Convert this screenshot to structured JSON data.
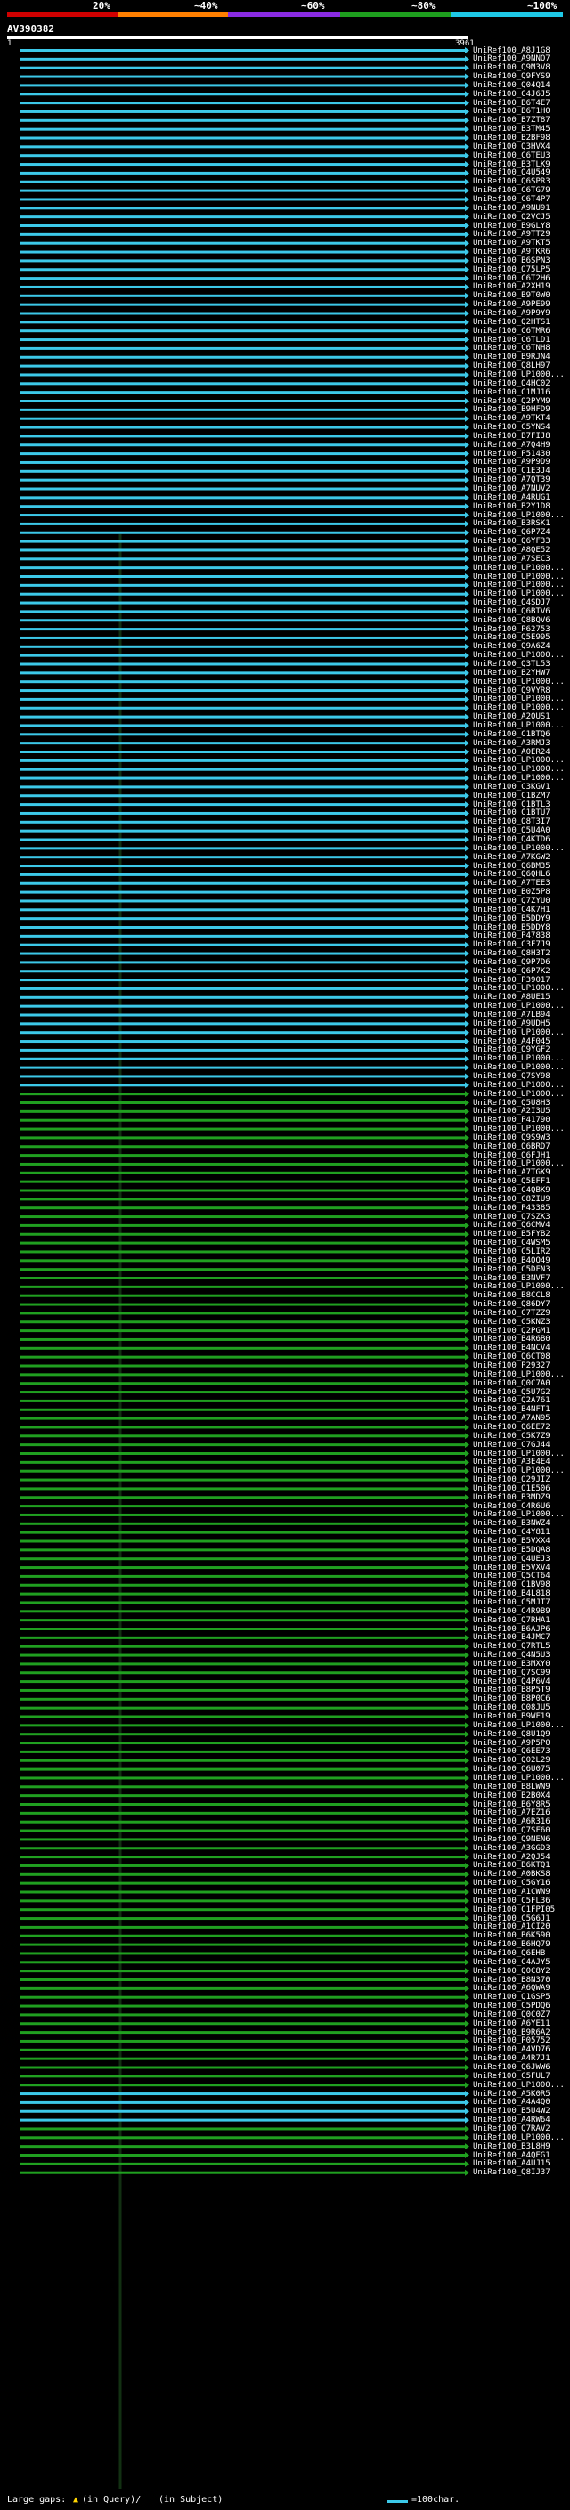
{
  "scale": {
    "labels": [
      "20%",
      "~40%",
      "~60%",
      "~80%",
      "~100%"
    ],
    "colors": [
      "#d00000",
      "#ff7f00",
      "#8a2be2",
      "#1e9e1e",
      "#1ec8e6"
    ]
  },
  "query": {
    "name": "AV390382",
    "start": "1",
    "end": "3961"
  },
  "colors": {
    "cyan": "#3cc8e8",
    "green": "#20a020",
    "dark": "#0a1a0a",
    "white": "#ffffff"
  },
  "hits": [
    {
      "label": "UniRef100_A8J1G8",
      "color": "cyan"
    },
    {
      "label": "UniRef100_A9NNQ7",
      "color": "cyan"
    },
    {
      "label": "UniRef100_Q9M3V8",
      "color": "cyan"
    },
    {
      "label": "UniRef100_Q9FYS9",
      "color": "cyan"
    },
    {
      "label": "UniRef100_Q04Q14",
      "color": "cyan"
    },
    {
      "label": "UniRef100_C4J6J5",
      "color": "cyan"
    },
    {
      "label": "UniRef100_B6T4E7",
      "color": "cyan"
    },
    {
      "label": "UniRef100_B6T1H0",
      "color": "cyan"
    },
    {
      "label": "UniRef100_B7ZT87",
      "color": "cyan"
    },
    {
      "label": "UniRef100_B3TM45",
      "color": "cyan"
    },
    {
      "label": "UniRef100_B2BF98",
      "color": "cyan"
    },
    {
      "label": "UniRef100_Q3HVX4",
      "color": "cyan"
    },
    {
      "label": "UniRef100_C6TEU3",
      "color": "cyan"
    },
    {
      "label": "UniRef100_B3TLK9",
      "color": "cyan"
    },
    {
      "label": "UniRef100_Q4U549",
      "color": "cyan"
    },
    {
      "label": "UniRef100_Q6SPR3",
      "color": "cyan"
    },
    {
      "label": "UniRef100_C6TG79",
      "color": "cyan"
    },
    {
      "label": "UniRef100_C6T4P7",
      "color": "cyan"
    },
    {
      "label": "UniRef100_A9NU91",
      "color": "cyan"
    },
    {
      "label": "UniRef100_Q2VCJ5",
      "color": "cyan"
    },
    {
      "label": "UniRef100_B9GLY8",
      "color": "cyan"
    },
    {
      "label": "UniRef100_A9TT29",
      "color": "cyan"
    },
    {
      "label": "UniRef100_A9TKT5",
      "color": "cyan"
    },
    {
      "label": "UniRef100_A9TKR6",
      "color": "cyan"
    },
    {
      "label": "UniRef100_B6SPN3",
      "color": "cyan"
    },
    {
      "label": "UniRef100_Q75LP5",
      "color": "cyan"
    },
    {
      "label": "UniRef100_C6T2H6",
      "color": "cyan"
    },
    {
      "label": "UniRef100_A2XH19",
      "color": "cyan"
    },
    {
      "label": "UniRef100_B9T0W0",
      "color": "cyan"
    },
    {
      "label": "UniRef100_A9PE99",
      "color": "cyan"
    },
    {
      "label": "UniRef100_A9P9Y9",
      "color": "cyan"
    },
    {
      "label": "UniRef100_Q2HTS1",
      "color": "cyan"
    },
    {
      "label": "UniRef100_C6TMR6",
      "color": "cyan"
    },
    {
      "label": "UniRef100_C6TLD1",
      "color": "cyan"
    },
    {
      "label": "UniRef100_C6TNH8",
      "color": "cyan"
    },
    {
      "label": "UniRef100_B9RJN4",
      "color": "cyan"
    },
    {
      "label": "UniRef100_Q8LH97",
      "color": "cyan"
    },
    {
      "label": "UniRef100_UP1000...",
      "color": "cyan"
    },
    {
      "label": "UniRef100_Q4HC02",
      "color": "cyan"
    },
    {
      "label": "UniRef100_C1MJ16",
      "color": "cyan"
    },
    {
      "label": "UniRef100_Q2PYM9",
      "color": "cyan"
    },
    {
      "label": "UniRef100_B9HFD9",
      "color": "cyan"
    },
    {
      "label": "UniRef100_A9TKT4",
      "color": "cyan"
    },
    {
      "label": "UniRef100_C5YNS4",
      "color": "cyan"
    },
    {
      "label": "UniRef100_B7FIJ8",
      "color": "cyan"
    },
    {
      "label": "UniRef100_A7Q4H9",
      "color": "cyan"
    },
    {
      "label": "UniRef100_P51430",
      "color": "cyan"
    },
    {
      "label": "UniRef100_A9P9D9",
      "color": "cyan"
    },
    {
      "label": "UniRef100_C1E3J4",
      "color": "cyan"
    },
    {
      "label": "UniRef100_A7QT39",
      "color": "cyan"
    },
    {
      "label": "UniRef100_A7NUV2",
      "color": "cyan"
    },
    {
      "label": "UniRef100_A4RUG1",
      "color": "cyan"
    },
    {
      "label": "UniRef100_B2Y1D8",
      "color": "cyan"
    },
    {
      "label": "UniRef100_UP1000...",
      "color": "cyan"
    },
    {
      "label": "UniRef100_B3RSK1",
      "color": "cyan"
    },
    {
      "label": "UniRef100_Q6P7Z4",
      "color": "cyan"
    },
    {
      "label": "UniRef100_Q6YF33",
      "color": "cyan"
    },
    {
      "label": "UniRef100_A8QE52",
      "color": "cyan"
    },
    {
      "label": "UniRef100_A7SEC3",
      "color": "cyan"
    },
    {
      "label": "UniRef100_UP1000...",
      "color": "cyan"
    },
    {
      "label": "UniRef100_UP1000...",
      "color": "cyan"
    },
    {
      "label": "UniRef100_UP1000...",
      "color": "cyan"
    },
    {
      "label": "UniRef100_UP1000...",
      "color": "cyan"
    },
    {
      "label": "UniRef100_Q4SDJ7",
      "color": "cyan"
    },
    {
      "label": "UniRef100_Q6BTV6",
      "color": "cyan"
    },
    {
      "label": "UniRef100_Q8BQV6",
      "color": "cyan"
    },
    {
      "label": "UniRef100_P62753",
      "color": "cyan"
    },
    {
      "label": "UniRef100_Q5E995",
      "color": "cyan"
    },
    {
      "label": "UniRef100_Q9A6Z4",
      "color": "cyan"
    },
    {
      "label": "UniRef100_UP1000...",
      "color": "cyan"
    },
    {
      "label": "UniRef100_Q3TL53",
      "color": "cyan"
    },
    {
      "label": "UniRef100_B2YHW7",
      "color": "cyan"
    },
    {
      "label": "UniRef100_UP1000...",
      "color": "cyan"
    },
    {
      "label": "UniRef100_Q9VYR8",
      "color": "cyan"
    },
    {
      "label": "UniRef100_UP1000...",
      "color": "cyan"
    },
    {
      "label": "UniRef100_UP1000...",
      "color": "cyan"
    },
    {
      "label": "UniRef100_A2QUS1",
      "color": "cyan"
    },
    {
      "label": "UniRef100_UP1000...",
      "color": "cyan"
    },
    {
      "label": "UniRef100_C1BTQ6",
      "color": "cyan"
    },
    {
      "label": "UniRef100_A3RMJ3",
      "color": "cyan"
    },
    {
      "label": "UniRef100_A0ER24",
      "color": "cyan"
    },
    {
      "label": "UniRef100_UP1000...",
      "color": "cyan"
    },
    {
      "label": "UniRef100_UP1000...",
      "color": "cyan"
    },
    {
      "label": "UniRef100_UP1000...",
      "color": "cyan"
    },
    {
      "label": "UniRef100_C3KGV1",
      "color": "cyan"
    },
    {
      "label": "UniRef100_C1BZM7",
      "color": "cyan"
    },
    {
      "label": "UniRef100_C1BTL3",
      "color": "cyan"
    },
    {
      "label": "UniRef100_C1BTU7",
      "color": "cyan"
    },
    {
      "label": "UniRef100_Q8T3I7",
      "color": "cyan"
    },
    {
      "label": "UniRef100_Q5U4A0",
      "color": "cyan"
    },
    {
      "label": "UniRef100_Q4KTD6",
      "color": "cyan"
    },
    {
      "label": "UniRef100_UP1000...",
      "color": "cyan"
    },
    {
      "label": "UniRef100_A7KGW2",
      "color": "cyan"
    },
    {
      "label": "UniRef100_Q6BM35",
      "color": "cyan"
    },
    {
      "label": "UniRef100_Q6QHL6",
      "color": "cyan"
    },
    {
      "label": "UniRef100_A7TEE3",
      "color": "cyan"
    },
    {
      "label": "UniRef100_B0Z5P8",
      "color": "cyan"
    },
    {
      "label": "UniRef100_Q7ZYU0",
      "color": "cyan"
    },
    {
      "label": "UniRef100_C4K7H1",
      "color": "cyan"
    },
    {
      "label": "UniRef100_B5DDY9",
      "color": "cyan"
    },
    {
      "label": "UniRef100_B5DDY8",
      "color": "cyan"
    },
    {
      "label": "UniRef100_P47838",
      "color": "cyan"
    },
    {
      "label": "UniRef100_C3F7J9",
      "color": "cyan"
    },
    {
      "label": "UniRef100_Q8H3T2",
      "color": "cyan"
    },
    {
      "label": "UniRef100_Q9P7D6",
      "color": "cyan"
    },
    {
      "label": "UniRef100_Q6P7K2",
      "color": "cyan"
    },
    {
      "label": "UniRef100_P39017",
      "color": "cyan"
    },
    {
      "label": "UniRef100_UP1000...",
      "color": "cyan"
    },
    {
      "label": "UniRef100_A8UE15",
      "color": "cyan"
    },
    {
      "label": "UniRef100_UP1000...",
      "color": "cyan"
    },
    {
      "label": "UniRef100_A7LB94",
      "color": "cyan"
    },
    {
      "label": "UniRef100_A9UDH5",
      "color": "cyan"
    },
    {
      "label": "UniRef100_UP1000...",
      "color": "cyan"
    },
    {
      "label": "UniRef100_A4F045",
      "color": "cyan"
    },
    {
      "label": "UniRef100_Q9YGF2",
      "color": "cyan"
    },
    {
      "label": "UniRef100_UP1000...",
      "color": "cyan"
    },
    {
      "label": "UniRef100_UP1000...",
      "color": "cyan"
    },
    {
      "label": "UniRef100_Q7SY98",
      "color": "cyan"
    },
    {
      "label": "UniRef100_UP1000...",
      "color": "cyan"
    },
    {
      "label": "UniRef100_UP1000...",
      "color": "green"
    },
    {
      "label": "UniRef100_Q5U8H3",
      "color": "green"
    },
    {
      "label": "UniRef100_A2I3U5",
      "color": "green"
    },
    {
      "label": "UniRef100_P41790",
      "color": "green"
    },
    {
      "label": "UniRef100_UP1000...",
      "color": "green"
    },
    {
      "label": "UniRef100_Q9S9W3",
      "color": "green"
    },
    {
      "label": "UniRef100_Q6BRD7",
      "color": "green"
    },
    {
      "label": "UniRef100_Q6FJH1",
      "color": "green"
    },
    {
      "label": "UniRef100_UP1000...",
      "color": "green"
    },
    {
      "label": "UniRef100_A7TGK9",
      "color": "green"
    },
    {
      "label": "UniRef100_Q5EFF1",
      "color": "green"
    },
    {
      "label": "UniRef100_C4QBK9",
      "color": "green"
    },
    {
      "label": "UniRef100_C8ZIU9",
      "color": "green"
    },
    {
      "label": "UniRef100_P43385",
      "color": "green"
    },
    {
      "label": "UniRef100_Q7SZK3",
      "color": "green"
    },
    {
      "label": "UniRef100_Q6CMV4",
      "color": "green"
    },
    {
      "label": "UniRef100_B5FYB2",
      "color": "green"
    },
    {
      "label": "UniRef100_C4WSM5",
      "color": "green"
    },
    {
      "label": "UniRef100_C5LIR2",
      "color": "green"
    },
    {
      "label": "UniRef100_B4QQ49",
      "color": "green"
    },
    {
      "label": "UniRef100_C5DFN3",
      "color": "green"
    },
    {
      "label": "UniRef100_B3NVF7",
      "color": "green"
    },
    {
      "label": "UniRef100_UP1000...",
      "color": "green"
    },
    {
      "label": "UniRef100_B8CCL8",
      "color": "green"
    },
    {
      "label": "UniRef100_Q86DY7",
      "color": "green"
    },
    {
      "label": "UniRef100_C7TZZ9",
      "color": "green"
    },
    {
      "label": "UniRef100_C5KNZ3",
      "color": "green"
    },
    {
      "label": "UniRef100_Q2PGM1",
      "color": "green"
    },
    {
      "label": "UniRef100_B4R6B0",
      "color": "green"
    },
    {
      "label": "UniRef100_B4NCV4",
      "color": "green"
    },
    {
      "label": "UniRef100_Q6CT08",
      "color": "green"
    },
    {
      "label": "UniRef100_P29327",
      "color": "green"
    },
    {
      "label": "UniRef100_UP1000...",
      "color": "green"
    },
    {
      "label": "UniRef100_Q0C7A0",
      "color": "green"
    },
    {
      "label": "UniRef100_Q5U7G2",
      "color": "green"
    },
    {
      "label": "UniRef100_Q2A761",
      "color": "green"
    },
    {
      "label": "UniRef100_B4NFT1",
      "color": "green"
    },
    {
      "label": "UniRef100_A7AN95",
      "color": "green"
    },
    {
      "label": "UniRef100_Q6EE72",
      "color": "green"
    },
    {
      "label": "UniRef100_C5K7Z9",
      "color": "green"
    },
    {
      "label": "UniRef100_C7GJ44",
      "color": "green"
    },
    {
      "label": "UniRef100_UP1000...",
      "color": "green"
    },
    {
      "label": "UniRef100_A3E4E4",
      "color": "green"
    },
    {
      "label": "UniRef100_UP1000...",
      "color": "green"
    },
    {
      "label": "UniRef100_Q29JIZ",
      "color": "green"
    },
    {
      "label": "UniRef100_Q1E506",
      "color": "green"
    },
    {
      "label": "UniRef100_B3MDZ9",
      "color": "green"
    },
    {
      "label": "UniRef100_C4R6U6",
      "color": "green"
    },
    {
      "label": "UniRef100_UP1000...",
      "color": "green"
    },
    {
      "label": "UniRef100_B3NWZ4",
      "color": "green"
    },
    {
      "label": "UniRef100_C4Y811",
      "color": "green"
    },
    {
      "label": "UniRef100_B5VXX4",
      "color": "green"
    },
    {
      "label": "UniRef100_B5DQA8",
      "color": "green"
    },
    {
      "label": "UniRef100_Q4UEJ3",
      "color": "green"
    },
    {
      "label": "UniRef100_B5VXV4",
      "color": "green"
    },
    {
      "label": "UniRef100_Q5CT64",
      "color": "green"
    },
    {
      "label": "UniRef100_C1BV98",
      "color": "green"
    },
    {
      "label": "UniRef100_B4L818",
      "color": "green"
    },
    {
      "label": "UniRef100_C5MJT7",
      "color": "green"
    },
    {
      "label": "UniRef100_C4R9B9",
      "color": "green"
    },
    {
      "label": "UniRef100_Q7RHA1",
      "color": "green"
    },
    {
      "label": "UniRef100_B6AJP6",
      "color": "green"
    },
    {
      "label": "UniRef100_B4JMC7",
      "color": "green"
    },
    {
      "label": "UniRef100_Q7RTL5",
      "color": "green"
    },
    {
      "label": "UniRef100_Q4N5U3",
      "color": "green"
    },
    {
      "label": "UniRef100_B3MXY0",
      "color": "green"
    },
    {
      "label": "UniRef100_Q7SC99",
      "color": "green"
    },
    {
      "label": "UniRef100_Q4P6V4",
      "color": "green"
    },
    {
      "label": "UniRef100_B8P5T9",
      "color": "green"
    },
    {
      "label": "UniRef100_B8P0C6",
      "color": "green"
    },
    {
      "label": "UniRef100_Q08JU5",
      "color": "green"
    },
    {
      "label": "UniRef100_B9WF19",
      "color": "green"
    },
    {
      "label": "UniRef100_UP1000...",
      "color": "green"
    },
    {
      "label": "UniRef100_Q8U1Q9",
      "color": "green"
    },
    {
      "label": "UniRef100_A9P5P0",
      "color": "green"
    },
    {
      "label": "UniRef100_Q6EE73",
      "color": "green"
    },
    {
      "label": "UniRef100_Q02L29",
      "color": "green"
    },
    {
      "label": "UniRef100_Q6U075",
      "color": "green"
    },
    {
      "label": "UniRef100_UP1000...",
      "color": "green"
    },
    {
      "label": "UniRef100_B8LWN9",
      "color": "green"
    },
    {
      "label": "UniRef100_B2B0X4",
      "color": "green"
    },
    {
      "label": "UniRef100_B6Y8R5",
      "color": "green"
    },
    {
      "label": "UniRef100_A7EZ16",
      "color": "green"
    },
    {
      "label": "UniRef100_A6R316",
      "color": "green"
    },
    {
      "label": "UniRef100_Q7SF60",
      "color": "green"
    },
    {
      "label": "UniRef100_Q9NEN6",
      "color": "green"
    },
    {
      "label": "UniRef100_A3GGD3",
      "color": "green"
    },
    {
      "label": "UniRef100_A2QJ54",
      "color": "green"
    },
    {
      "label": "UniRef100_B6KTQ1",
      "color": "green"
    },
    {
      "label": "UniRef100_A0BKS8",
      "color": "green"
    },
    {
      "label": "UniRef100_C5GY16",
      "color": "green"
    },
    {
      "label": "UniRef100_A1CWN9",
      "color": "green"
    },
    {
      "label": "UniRef100_C5FL36",
      "color": "green"
    },
    {
      "label": "UniRef100_C1FPI05",
      "color": "green"
    },
    {
      "label": "UniRef100_C5G6J1",
      "color": "green"
    },
    {
      "label": "UniRef100_A1CI20",
      "color": "green"
    },
    {
      "label": "UniRef100_B6K590",
      "color": "green"
    },
    {
      "label": "UniRef100_B6HQ79",
      "color": "green"
    },
    {
      "label": "UniRef100_Q6EHB",
      "color": "green"
    },
    {
      "label": "UniRef100_C4AJY5",
      "color": "green"
    },
    {
      "label": "UniRef100_Q0C8Y2",
      "color": "green"
    },
    {
      "label": "UniRef100_B8N370",
      "color": "green"
    },
    {
      "label": "UniRef100_A6QWA9",
      "color": "green"
    },
    {
      "label": "UniRef100_Q1GSP5",
      "color": "green"
    },
    {
      "label": "UniRef100_C5PDQ6",
      "color": "green"
    },
    {
      "label": "UniRef100_Q0C0Z7",
      "color": "green"
    },
    {
      "label": "UniRef100_A6YE11",
      "color": "green"
    },
    {
      "label": "UniRef100_B9R6A2",
      "color": "green"
    },
    {
      "label": "UniRef100_P05752",
      "color": "green"
    },
    {
      "label": "UniRef100_A4VD76",
      "color": "green"
    },
    {
      "label": "UniRef100_A4R7J1",
      "color": "green"
    },
    {
      "label": "UniRef100_Q6JWW6",
      "color": "green"
    },
    {
      "label": "UniRef100_C5FUL7",
      "color": "green"
    },
    {
      "label": "UniRef100_UP1000...",
      "color": "green"
    },
    {
      "label": "UniRef100_A5K0R5",
      "color": "cyan"
    },
    {
      "label": "UniRef100_A4A4Q0",
      "color": "cyan"
    },
    {
      "label": "UniRef100_B5U4W2",
      "color": "cyan"
    },
    {
      "label": "UniRef100_A4RW64",
      "color": "cyan"
    },
    {
      "label": "UniRef100_Q7RAV2",
      "color": "green"
    },
    {
      "label": "UniRef100_UP1000...",
      "color": "green"
    },
    {
      "label": "UniRef100_B3L8H9",
      "color": "green"
    },
    {
      "label": "UniRef100_A4QEG1",
      "color": "green"
    },
    {
      "label": "UniRef100_A4UJ15",
      "color": "green"
    },
    {
      "label": "UniRef100_Q8IJ37",
      "color": "green"
    }
  ],
  "legend": {
    "gaps": "Large gaps:",
    "in_query": "(in Query)/",
    "in_subject": "(in Subject)",
    "scale": "=100char."
  }
}
